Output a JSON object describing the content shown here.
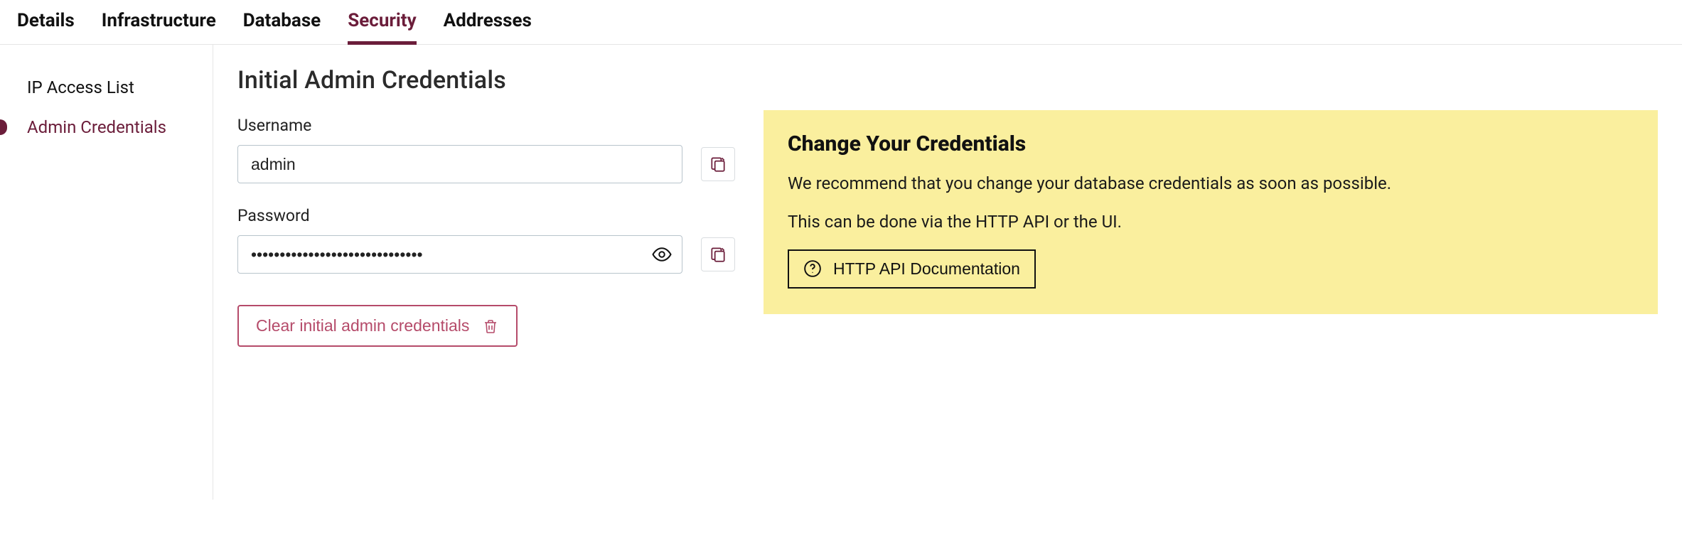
{
  "tabs": [
    {
      "label": "Details",
      "active": false
    },
    {
      "label": "Infrastructure",
      "active": false
    },
    {
      "label": "Database",
      "active": false
    },
    {
      "label": "Security",
      "active": true
    },
    {
      "label": "Addresses",
      "active": false
    }
  ],
  "sidebar": {
    "items": [
      {
        "label": "IP Access List",
        "active": false
      },
      {
        "label": "Admin Credentials",
        "active": true
      }
    ]
  },
  "page": {
    "title": "Initial Admin Credentials",
    "username_label": "Username",
    "username_value": "admin",
    "password_label": "Password",
    "password_masked": "••••••••••••••••••••••••••••••",
    "clear_button": "Clear initial admin credentials"
  },
  "notice": {
    "title": "Change Your Credentials",
    "body1": "We recommend that you change your database credentials as soon as possible.",
    "body2": "This can be done via the HTTP API or the UI.",
    "doc_button": "HTTP API Documentation"
  },
  "icons": {
    "copy": "copy",
    "eye": "eye",
    "trash": "trash",
    "help": "help"
  }
}
